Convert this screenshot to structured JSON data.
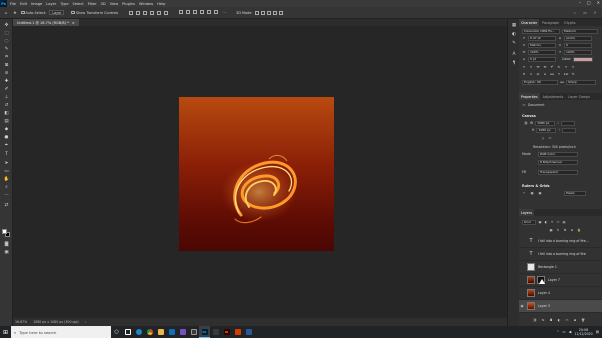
{
  "app": {
    "logo": "Ps",
    "menu": [
      "File",
      "Edit",
      "Image",
      "Layer",
      "Type",
      "Select",
      "Filter",
      "3D",
      "View",
      "Plugins",
      "Window",
      "Help"
    ],
    "window_controls": [
      "–",
      "□",
      "✕"
    ]
  },
  "options": {
    "auto_select_label": "Auto-Select:",
    "auto_select_value": "Layer",
    "show_transform_label": "Show Transform Controls",
    "mode_3d_label": "3D Mode:"
  },
  "document": {
    "tab_label": "Untitled-1 @ 16.7% (RGB/8) *",
    "close_glyph": "×"
  },
  "status": {
    "zoom": "16.67%",
    "doc_size": "1080 px x 1080 px (300 ppi)"
  },
  "character": {
    "tabs": [
      "Character",
      "Paragraph",
      "Glyphs"
    ],
    "font_family": "Clarendon URW Ex...",
    "font_style": "Medium",
    "size": "6.47 pt",
    "leading": "(Auto)",
    "kerning": "Metrics",
    "tracking": "0",
    "scale_v": "100%",
    "scale_h": "100%",
    "baseline": "0 pt",
    "color_label": "Color:",
    "color_hex": "#c8a2a4",
    "language": "English: UK",
    "aa": "Sharp"
  },
  "properties": {
    "tabs": [
      "Properties",
      "Adjustments",
      "Layer Comps"
    ],
    "doc_type": "Document",
    "canvas_title": "Canvas",
    "width": "1080 px",
    "height": "1080 px",
    "w_label": "W",
    "h_label": "H",
    "x_label": "X",
    "y_label": "Y",
    "resolution": "Resolution: 300 pixels/inch",
    "mode_label": "Mode",
    "mode_value": "RGB Color",
    "bit_value": "8 Bits/Channel",
    "fill_label": "Fill",
    "fill_value": "Transparent",
    "rulers_title": "Rulers & Grids",
    "ruler_unit": "Pixels"
  },
  "layers": {
    "tab_label": "Layers",
    "kind_filter": "Kind",
    "items": [
      {
        "name": "I fall into a burning ring of fire...",
        "type": "text"
      },
      {
        "name": "I fell into a burning ring of fire",
        "type": "text"
      },
      {
        "name": "Rectangle 1",
        "type": "shape"
      },
      {
        "name": "Layer 7",
        "type": "mask"
      },
      {
        "name": "Layer 4",
        "type": "image"
      },
      {
        "name": "Layer 3",
        "type": "image",
        "selected": true
      }
    ]
  },
  "taskbar": {
    "search_placeholder": "Type here to search",
    "time": "20:06",
    "date": "11/12/2020"
  }
}
